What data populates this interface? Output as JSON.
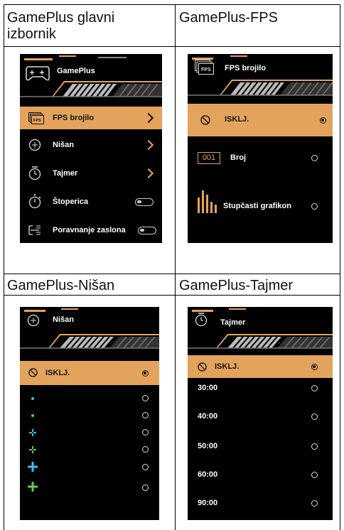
{
  "cells": {
    "menu_title": [
      "GamePlus glavni",
      "izbornik"
    ],
    "fps_title": "GamePlus-FPS",
    "crosshair_title": "GamePlus-Nišan",
    "timer_title": "GamePlus-Tajmer"
  },
  "main_menu": {
    "header": "GamePlus",
    "items": [
      {
        "label": "FPS brojilo",
        "icon": "fps-icon",
        "control": "chevron"
      },
      {
        "label": "Nišan",
        "icon": "crosshair-icon",
        "control": "chevron"
      },
      {
        "label": "Tajmer",
        "icon": "timer-icon",
        "control": "chevron"
      },
      {
        "label": "Štoperica",
        "icon": "stopwatch-icon",
        "control": "toggle"
      },
      {
        "label": "Poravnanje zaslona",
        "icon": "align-icon",
        "control": "toggle"
      }
    ]
  },
  "fps_menu": {
    "header": "FPS brojilo",
    "off": "ISKLJ.",
    "number_badge": "001",
    "number": "Broj",
    "bar": "Stupčasti grafikon"
  },
  "crosshair_menu": {
    "header": "Nišan",
    "off": "ISKLJ.",
    "options": [
      {
        "icon": "dot-cyan-icon",
        "color": "#3ec1e8"
      },
      {
        "icon": "dot-green-icon",
        "color": "#66c94a"
      },
      {
        "icon": "cross-small-cyan-icon",
        "color": "#3ec1e8"
      },
      {
        "icon": "cross-small-green-icon",
        "color": "#66c94a"
      },
      {
        "icon": "cross-large-cyan-icon",
        "color": "#3ec1e8"
      },
      {
        "icon": "cross-large-green-icon",
        "color": "#66c94a"
      }
    ]
  },
  "timer_menu": {
    "header": "Tajmer",
    "off": "ISKLJ.",
    "times": [
      "30:00",
      "40:00",
      "50:00",
      "60:00",
      "90:00"
    ]
  },
  "colors": {
    "accent": "#e3a35c",
    "screen_bg": "#000000"
  }
}
